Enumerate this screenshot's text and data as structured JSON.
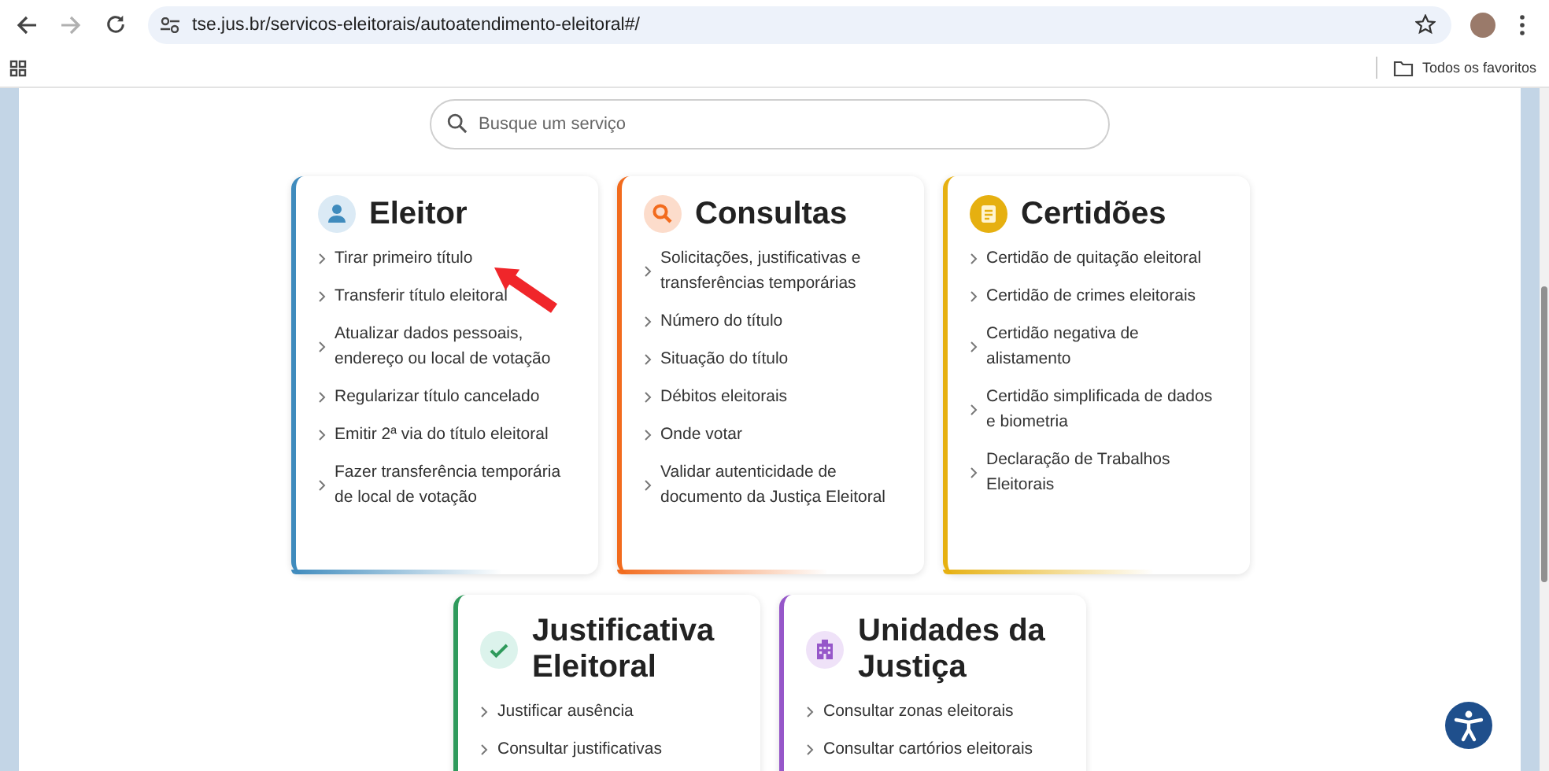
{
  "browser": {
    "url": "tse.jus.br/servicos-eleitorais/autoatendimento-eleitoral#/",
    "forward_disabled": true,
    "bookmarks_folder": "Todos os favoritos"
  },
  "search": {
    "placeholder": "Busque um serviço"
  },
  "cards": [
    {
      "title": "Eleitor",
      "kind": "person",
      "color": "#3f8bbd",
      "items": [
        "Tirar primeiro título",
        "Transferir título eleitoral",
        "Atualizar dados pessoais, endereço ou local de votação",
        "Regularizar título cancelado",
        "Emitir 2ª via do título eleitoral",
        "Fazer transferência temporária de local de votação"
      ]
    },
    {
      "title": "Consultas",
      "kind": "search",
      "color": "#f26b1d",
      "items": [
        "Solicitações, justificativas e transferências temporárias",
        "Número do título",
        "Situação do título",
        "Débitos eleitorais",
        "Onde votar",
        "Validar autenticidade de documento da Justiça Eleitoral"
      ]
    },
    {
      "title": "Certidões",
      "kind": "document",
      "color": "#e6b010",
      "items": [
        "Certidão de quitação eleitoral",
        "Certidão de crimes eleitorais",
        "Certidão negativa de alistamento",
        "Certidão simplificada de dados e biometria",
        "Declaração de Trabalhos Eleitorais"
      ]
    },
    {
      "title": "Justificativa Eleitoral",
      "kind": "check",
      "color": "#2f9a5c",
      "items": [
        "Justificar ausência",
        "Consultar justificativas"
      ]
    },
    {
      "title": "Unidades da Justiça",
      "kind": "building",
      "color": "#9657c9",
      "items": [
        "Consultar zonas eleitorais",
        "Consultar cartórios eleitorais"
      ]
    }
  ],
  "annotation": {
    "kind": "arrow"
  }
}
